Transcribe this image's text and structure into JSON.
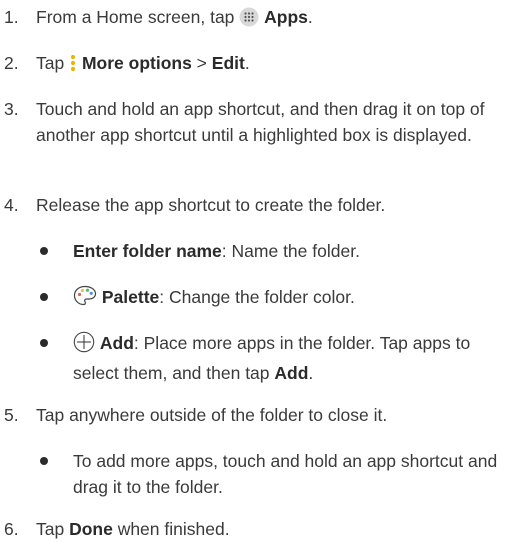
{
  "steps": [
    {
      "num": "1.",
      "a": "From a Home screen, tap ",
      "bold": "Apps",
      "b": "."
    },
    {
      "num": "2.",
      "a": "Tap ",
      "bold": "More options",
      "sep": " > ",
      "bold2": "Edit",
      "b": "."
    },
    {
      "num": "3.",
      "text": "Touch and hold an app shortcut, and then drag it on top of another app shortcut until a highlighted box is displayed."
    },
    {
      "num": "4.",
      "text": "Release the app shortcut to create the folder."
    },
    {
      "num": "5.",
      "text": "Tap anywhere outside of the folder to close it."
    },
    {
      "num": "6.",
      "a": "Tap ",
      "bold": "Done",
      "b": " when finished."
    }
  ],
  "bullets4": [
    {
      "bold": "Enter folder name",
      "text": ": Name the folder."
    },
    {
      "bold": "Palette",
      "text": ": Change the folder color."
    },
    {
      "bold": "Add",
      "text": ": Place more apps in the folder. Tap apps to select them, and then tap ",
      "bold2": "Add",
      "end": "."
    }
  ],
  "bullets5": [
    {
      "text": "To add more apps, touch and hold an app shortcut and drag it to the folder."
    }
  ],
  "icons": {
    "apps": "apps-grid-icon",
    "more": "more-options-icon",
    "palette": "palette-icon",
    "add": "add-circle-icon"
  }
}
